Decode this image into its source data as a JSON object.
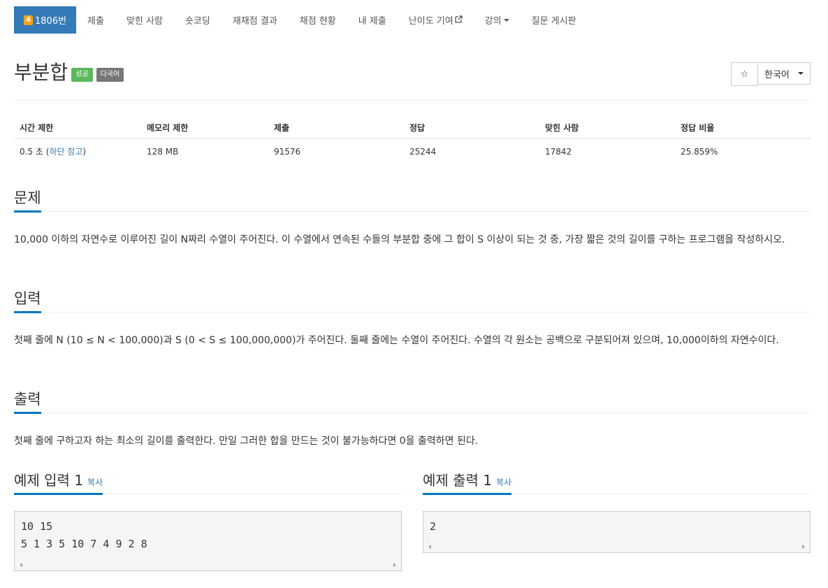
{
  "nav": {
    "problem_id": "1806번",
    "tier": "4",
    "items": [
      "제출",
      "맞힌 사람",
      "숏코딩",
      "재채점 결과",
      "채점 현황",
      "내 제출",
      "난이도 기여",
      "강의",
      "질문 게시판"
    ]
  },
  "problem": {
    "title": "부분합",
    "badges": [
      "성공",
      "다국어"
    ],
    "star_icon": "☆",
    "language": "한국어"
  },
  "info": {
    "headers": [
      "시간 제한",
      "메모리 제한",
      "제출",
      "정답",
      "맞힌 사람",
      "정답 비율"
    ],
    "time_value": "0.5 초 (",
    "time_link": "하단 참고",
    "time_close": ")",
    "memory": "128 MB",
    "submissions": "91576",
    "accepted": "25244",
    "solvers": "17842",
    "ratio": "25.859%"
  },
  "sections": {
    "problem_title": "문제",
    "problem_text": "10,000 이하의 자연수로 이루어진 길이 N짜리 수열이 주어진다. 이 수열에서 연속된 수들의 부분합 중에 그 합이 S 이상이 되는 것 중, 가장 짧은 것의 길이를 구하는 프로그램을 작성하시오.",
    "input_title": "입력",
    "input_text": "첫째 줄에 N (10 ≤ N < 100,000)과 S (0 < S ≤ 100,000,000)가 주어진다. 둘째 줄에는 수열이 주어진다. 수열의 각 원소는 공백으로 구분되어져 있으며, 10,000이하의 자연수이다.",
    "output_title": "출력",
    "output_text": "첫째 줄에 구하고자 하는 최소의 길이를 출력한다. 만일 그러한 합을 만드는 것이 불가능하다면 0을 출력하면 된다."
  },
  "samples": {
    "input_title": "예제 입력 1",
    "output_title": "예제 출력 1",
    "copy_label": "복사",
    "input_text": "10 15\n5 1 3 5 10 7 4 9 2 8",
    "output_text": "2"
  }
}
